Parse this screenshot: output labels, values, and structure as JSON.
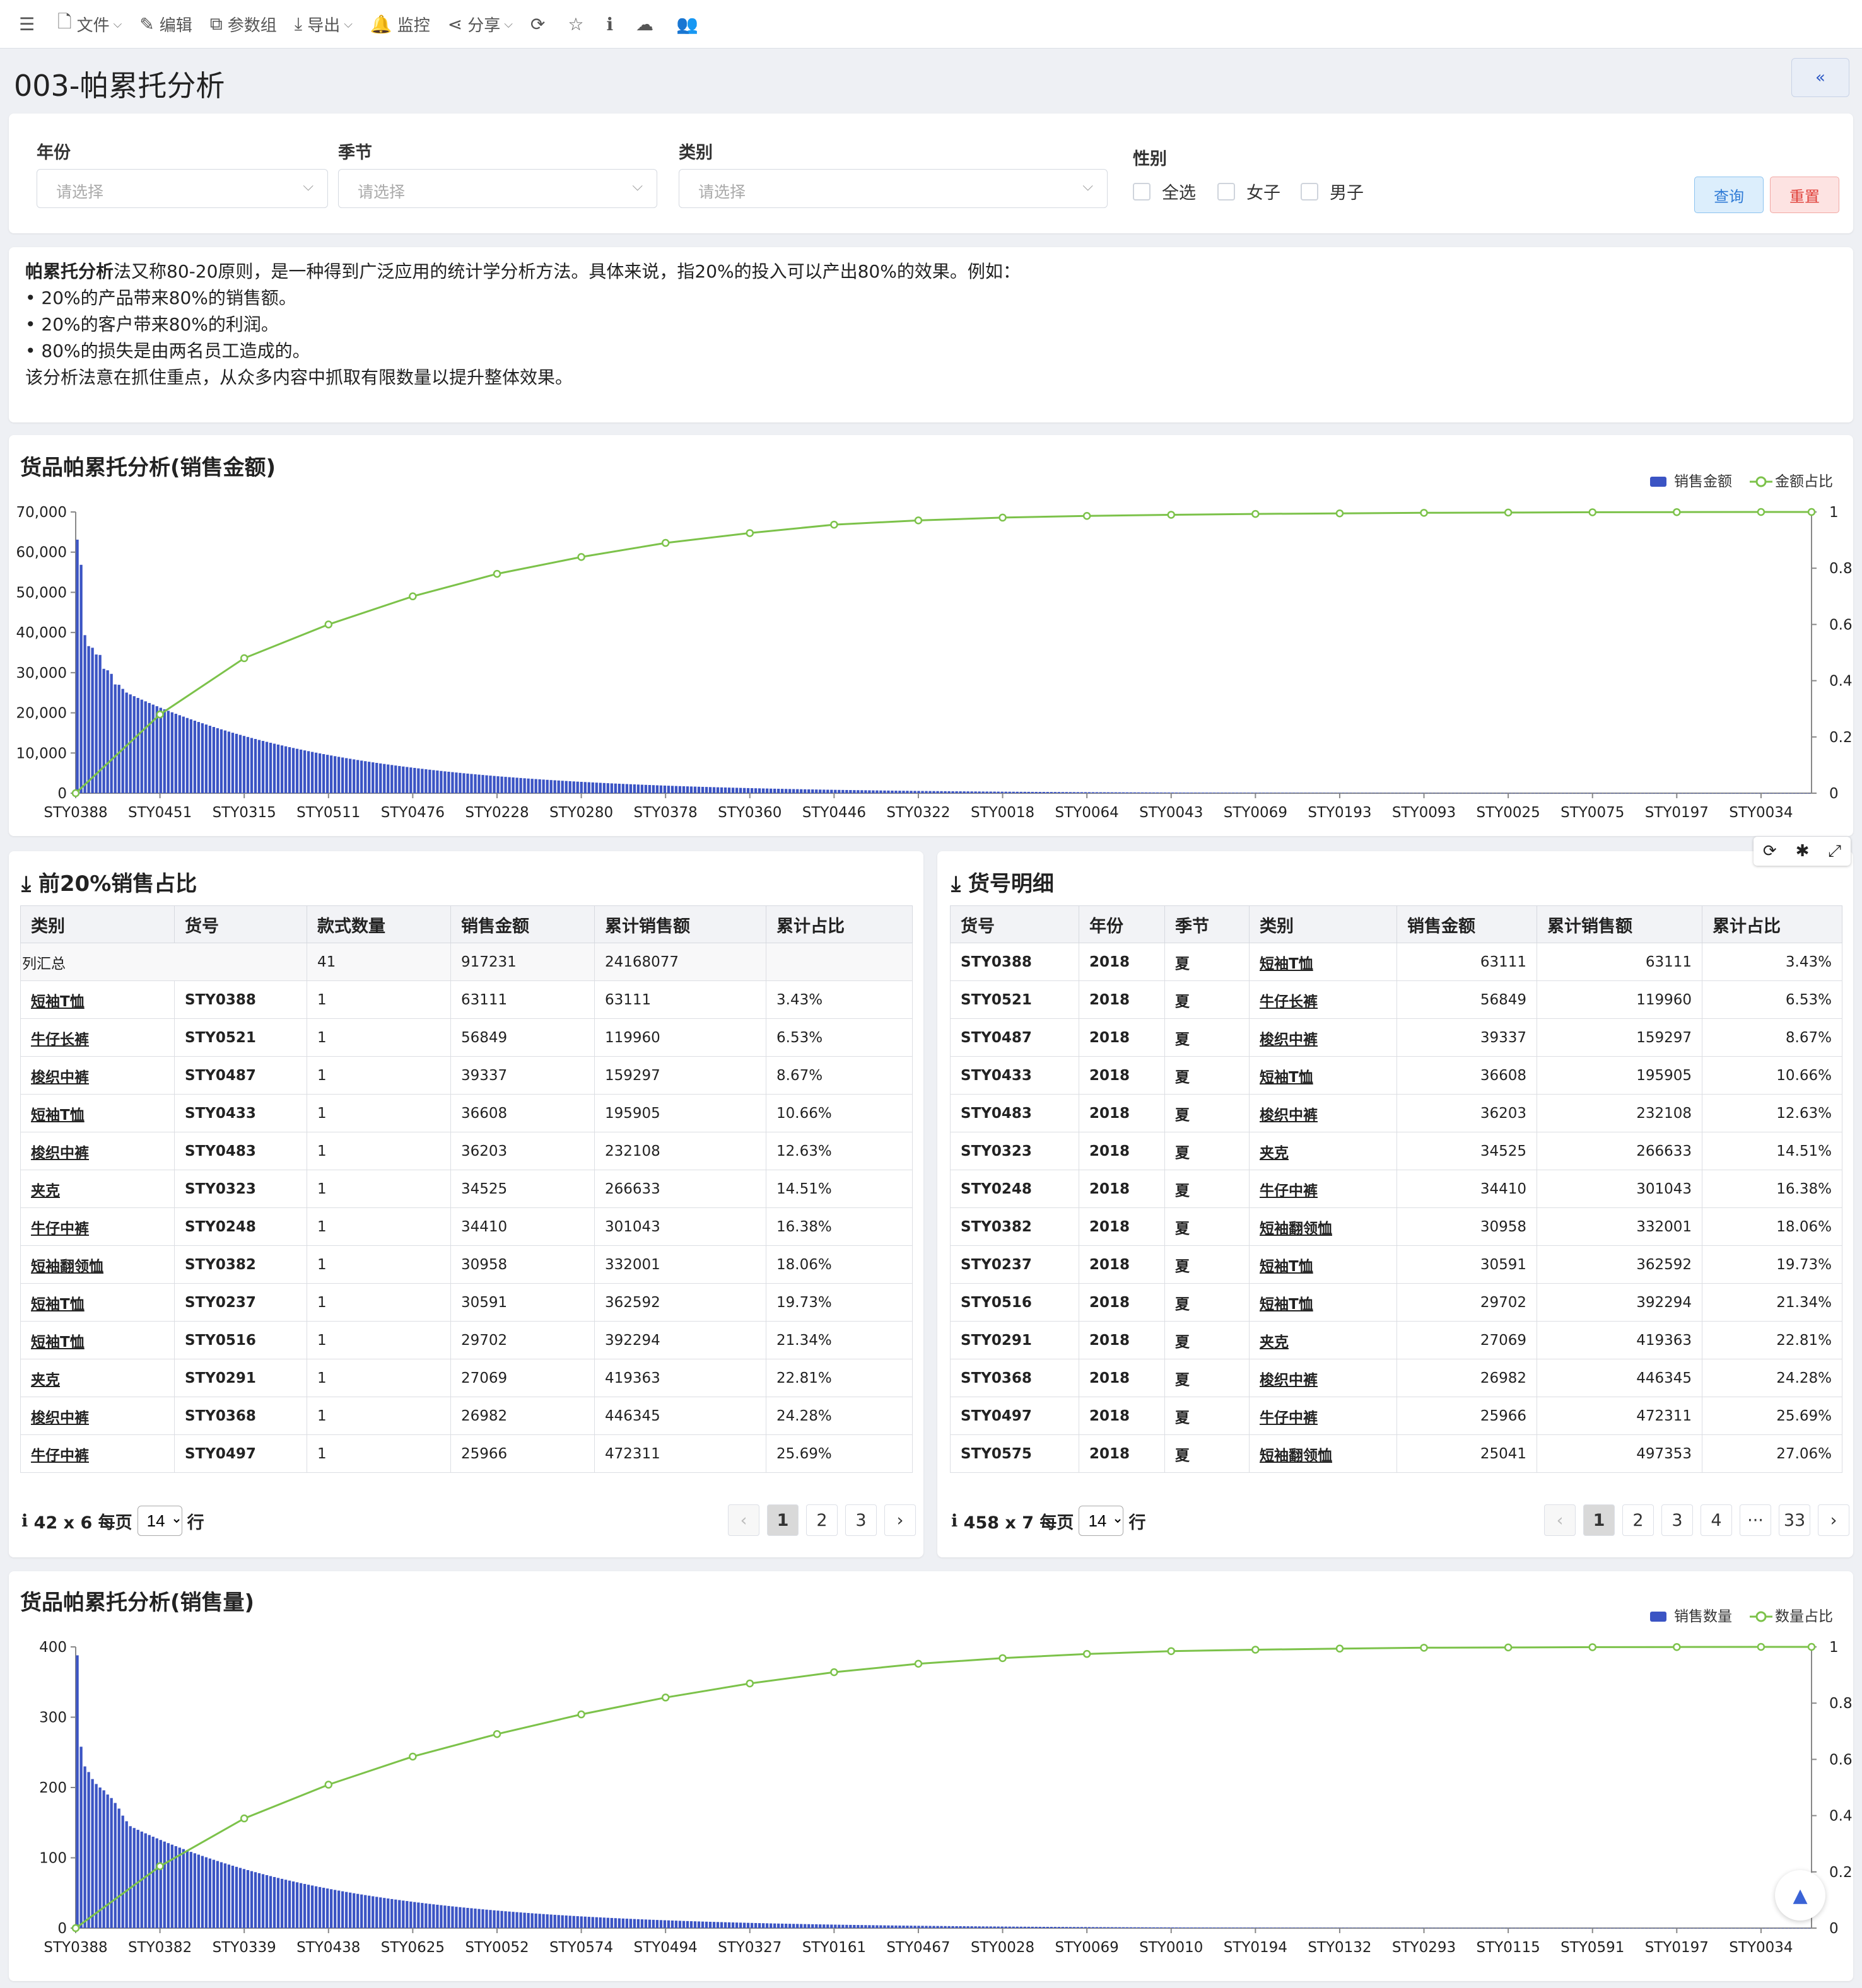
{
  "toolbar": {
    "items": [
      {
        "icon": "menu-icon",
        "glyph": "☰",
        "label": "",
        "caret": ""
      },
      {
        "icon": "file-icon",
        "glyph": "🗋",
        "label": "文件",
        "caret": "⌵"
      },
      {
        "icon": "edit-icon",
        "glyph": "✎",
        "label": "编辑",
        "caret": ""
      },
      {
        "icon": "param-group-icon",
        "glyph": "⧉",
        "label": "参数组",
        "caret": ""
      },
      {
        "icon": "export-icon",
        "glyph": "⤓",
        "label": "导出",
        "caret": "⌵"
      },
      {
        "icon": "bell-icon",
        "glyph": "🔔",
        "label": "监控",
        "caret": ""
      },
      {
        "icon": "share-icon",
        "glyph": "⋖",
        "label": "分享",
        "caret": "⌵"
      },
      {
        "icon": "refresh-icon",
        "glyph": "⟳",
        "label": "",
        "caret": ""
      },
      {
        "icon": "star-icon",
        "glyph": "☆",
        "label": "",
        "caret": ""
      },
      {
        "icon": "info-icon",
        "glyph": "ℹ",
        "label": "",
        "caret": ""
      },
      {
        "icon": "cloud-icon",
        "glyph": "☁",
        "label": "",
        "caret": ""
      },
      {
        "icon": "users-icon",
        "glyph": "👥",
        "label": "",
        "caret": ""
      }
    ]
  },
  "page": {
    "title": "003-帕累托分析",
    "collapse_icon": "«"
  },
  "filters": {
    "year": {
      "label": "年份",
      "placeholder": "请选择"
    },
    "season": {
      "label": "季节",
      "placeholder": "请选择"
    },
    "category": {
      "label": "类别",
      "placeholder": "请选择"
    },
    "gender": {
      "label": "性别",
      "options": [
        "全选",
        "女子",
        "男子"
      ]
    },
    "query_label": "查询",
    "reset_label": "重置"
  },
  "description": {
    "bold": "帕累托分析",
    "first_line": "法又称80-20原则，是一种得到广泛应用的统计学分析方法。具体来说，指20%的投入可以产出80%的效果。例如：",
    "bullets": [
      "• 20%的产品带来80%的销售额。",
      "• 20%的客户带来80%的利润。",
      "• 80%的损失是由两名员工造成的。"
    ],
    "last_line": "该分析法意在抓住重点，从众多内容中抓取有限数量以提升整体效果。"
  },
  "colors": {
    "bar": "#3b54c4",
    "line": "#7cc24a",
    "accent": "#2b57c4",
    "reset": "#e0413b"
  },
  "chart_data": [
    {
      "type": "bar",
      "title": "货品帕累托分析(销售金额)",
      "series": [
        {
          "name": "销售金额",
          "type": "bar",
          "axis": "left"
        },
        {
          "name": "金额占比",
          "type": "line",
          "axis": "right"
        }
      ],
      "x_tick_labels": [
        "STY0388",
        "STY0451",
        "STY0315",
        "STY0511",
        "STY0476",
        "STY0228",
        "STY0280",
        "STY0378",
        "STY0360",
        "STY0446",
        "STY0322",
        "STY0018",
        "STY0064",
        "STY0043",
        "STY0069",
        "STY0193",
        "STY0093",
        "STY0025",
        "STY0075",
        "STY0197",
        "STY0034"
      ],
      "y_left": {
        "ticks": [
          "70,000",
          "60,000",
          "50,000",
          "40,000",
          "30,000",
          "20,000",
          "10,000",
          "0"
        ],
        "ylim": [
          0,
          70000
        ]
      },
      "y_right": {
        "ticks": [
          "1",
          "0.8",
          "0.6",
          "0.4",
          "0.2",
          "0"
        ],
        "ylim": [
          0,
          1
        ]
      },
      "bar_count": 458,
      "bar_values_head": [
        63111,
        56849,
        39337,
        36608,
        36203,
        34525,
        34410,
        30958,
        30591,
        29702,
        27069,
        26982,
        25966,
        25041
      ],
      "cumulative_ratio": [
        0.0,
        0.28,
        0.48,
        0.6,
        0.7,
        0.78,
        0.84,
        0.89,
        0.925,
        0.955,
        0.97,
        0.98,
        0.986,
        0.99,
        0.993,
        0.995,
        0.997,
        0.998,
        0.999,
        0.9995,
        1,
        1
      ],
      "legend_position": "top-right"
    },
    {
      "type": "bar",
      "title": "货品帕累托分析(销售量)",
      "series": [
        {
          "name": "销售数量",
          "type": "bar",
          "axis": "left"
        },
        {
          "name": "数量占比",
          "type": "line",
          "axis": "right"
        }
      ],
      "x_tick_labels": [
        "STY0388",
        "STY0382",
        "STY0339",
        "STY0438",
        "STY0625",
        "STY0052",
        "STY0574",
        "STY0494",
        "STY0327",
        "STY0161",
        "STY0467",
        "STY0028",
        "STY0069",
        "STY0010",
        "STY0194",
        "STY0132",
        "STY0293",
        "STY0115",
        "STY0591",
        "STY0197",
        "STY0034"
      ],
      "y_left": {
        "ticks": [
          "400",
          "300",
          "200",
          "100",
          "0"
        ],
        "ylim": [
          0,
          400
        ]
      },
      "y_right": {
        "ticks": [
          "1",
          "0.8",
          "0.6",
          "0.4",
          "0.2",
          "0"
        ],
        "ylim": [
          0,
          1
        ]
      },
      "bar_count": 458,
      "bar_values_head": [
        388,
        258,
        230,
        222,
        212,
        205,
        200,
        196,
        190,
        185,
        178,
        170,
        160,
        152,
        145
      ],
      "cumulative_ratio": [
        0.0,
        0.22,
        0.39,
        0.51,
        0.61,
        0.69,
        0.76,
        0.82,
        0.87,
        0.91,
        0.94,
        0.96,
        0.975,
        0.985,
        0.99,
        0.994,
        0.997,
        0.998,
        0.999,
        0.9995,
        1,
        1
      ],
      "legend_position": "top-right"
    }
  ],
  "top20": {
    "title": "前20%销售占比",
    "download_icon": "⤓",
    "headers": [
      "类别",
      "货号",
      "款式数量",
      "销售金额",
      "累计销售额",
      "累计占比"
    ],
    "summary": [
      "列汇总",
      "",
      "41",
      "917231",
      "24168077",
      ""
    ],
    "rows": [
      [
        "短袖T恤",
        "STY0388",
        "1",
        "63111",
        "63111",
        "3.43%"
      ],
      [
        "牛仔长裤",
        "STY0521",
        "1",
        "56849",
        "119960",
        "6.53%"
      ],
      [
        "梭织中裤",
        "STY0487",
        "1",
        "39337",
        "159297",
        "8.67%"
      ],
      [
        "短袖T恤",
        "STY0433",
        "1",
        "36608",
        "195905",
        "10.66%"
      ],
      [
        "梭织中裤",
        "STY0483",
        "1",
        "36203",
        "232108",
        "12.63%"
      ],
      [
        "夹克",
        "STY0323",
        "1",
        "34525",
        "266633",
        "14.51%"
      ],
      [
        "牛仔中裤",
        "STY0248",
        "1",
        "34410",
        "301043",
        "16.38%"
      ],
      [
        "短袖翻领恤",
        "STY0382",
        "1",
        "30958",
        "332001",
        "18.06%"
      ],
      [
        "短袖T恤",
        "STY0237",
        "1",
        "30591",
        "362592",
        "19.73%"
      ],
      [
        "短袖T恤",
        "STY0516",
        "1",
        "29702",
        "392294",
        "21.34%"
      ],
      [
        "夹克",
        "STY0291",
        "1",
        "27069",
        "419363",
        "22.81%"
      ],
      [
        "梭织中裤",
        "STY0368",
        "1",
        "26982",
        "446345",
        "24.28%"
      ],
      [
        "牛仔中裤",
        "STY0497",
        "1",
        "25966",
        "472311",
        "25.69%"
      ]
    ],
    "info": "42 x 6 每页",
    "page_size": "14",
    "rows_label": "行",
    "pages": [
      "1",
      "2",
      "3"
    ]
  },
  "detail": {
    "title": "货号明细",
    "download_icon": "⤓",
    "headers": [
      "货号",
      "年份",
      "季节",
      "类别",
      "销售金额",
      "累计销售额",
      "累计占比"
    ],
    "rows": [
      [
        "STY0388",
        "2018",
        "夏",
        "短袖T恤",
        "63111",
        "63111",
        "3.43%"
      ],
      [
        "STY0521",
        "2018",
        "夏",
        "牛仔长裤",
        "56849",
        "119960",
        "6.53%"
      ],
      [
        "STY0487",
        "2018",
        "夏",
        "梭织中裤",
        "39337",
        "159297",
        "8.67%"
      ],
      [
        "STY0433",
        "2018",
        "夏",
        "短袖T恤",
        "36608",
        "195905",
        "10.66%"
      ],
      [
        "STY0483",
        "2018",
        "夏",
        "梭织中裤",
        "36203",
        "232108",
        "12.63%"
      ],
      [
        "STY0323",
        "2018",
        "夏",
        "夹克",
        "34525",
        "266633",
        "14.51%"
      ],
      [
        "STY0248",
        "2018",
        "夏",
        "牛仔中裤",
        "34410",
        "301043",
        "16.38%"
      ],
      [
        "STY0382",
        "2018",
        "夏",
        "短袖翻领恤",
        "30958",
        "332001",
        "18.06%"
      ],
      [
        "STY0237",
        "2018",
        "夏",
        "短袖T恤",
        "30591",
        "362592",
        "19.73%"
      ],
      [
        "STY0516",
        "2018",
        "夏",
        "短袖T恤",
        "29702",
        "392294",
        "21.34%"
      ],
      [
        "STY0291",
        "2018",
        "夏",
        "夹克",
        "27069",
        "419363",
        "22.81%"
      ],
      [
        "STY0368",
        "2018",
        "夏",
        "梭织中裤",
        "26982",
        "446345",
        "24.28%"
      ],
      [
        "STY0497",
        "2018",
        "夏",
        "牛仔中裤",
        "25966",
        "472311",
        "25.69%"
      ],
      [
        "STY0575",
        "2018",
        "夏",
        "短袖翻领恤",
        "25041",
        "497353",
        "27.06%"
      ]
    ],
    "info": "458 x 7 每页",
    "page_size": "14",
    "rows_label": "行",
    "pages": [
      "1",
      "2",
      "3",
      "4",
      "···",
      "33"
    ],
    "tools": [
      "⟳",
      "✱",
      "⤢"
    ]
  },
  "scroll_top_icon": "▲"
}
